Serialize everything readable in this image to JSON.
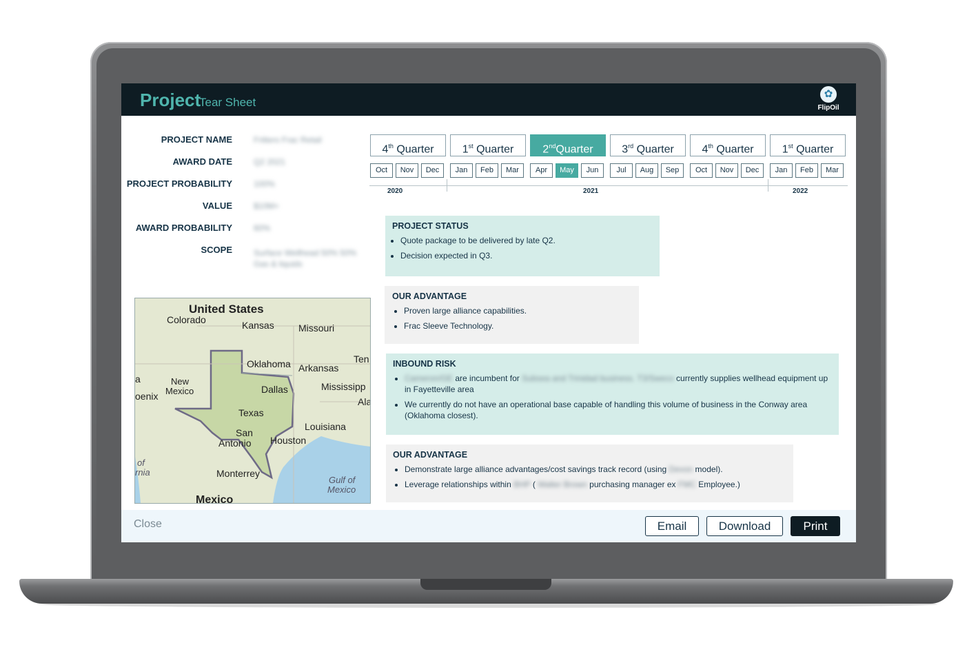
{
  "header": {
    "title": "Project",
    "subtitle": "Tear Sheet",
    "logo": "FlipOil"
  },
  "fields": [
    {
      "label": "PROJECT NAME",
      "value": "Fritters Frac Retail"
    },
    {
      "label": "AWARD DATE",
      "value": "Q2 2021"
    },
    {
      "label": "PROJECT PROBABILITY",
      "value": "100%"
    },
    {
      "label": "VALUE",
      "value": "$10M+"
    },
    {
      "label": "AWARD PROBABILITY",
      "value": "60%"
    },
    {
      "label": "SCOPE",
      "value": "Surface Wellhead 50% 50% Gas & liquids"
    }
  ],
  "map": {
    "labels": [
      "United States",
      "Colorado",
      "Kansas",
      "Missouri",
      "Oklahoma",
      "Arkansas",
      "Ten",
      "New Mexico",
      "Dallas",
      "Mississipp",
      "Ala",
      "oenix",
      "a",
      "Texas",
      "Louisiana",
      "San Antonio",
      "Houston",
      "Monterrey",
      "Gulf of Mexico",
      "Mexico",
      "of rnia"
    ]
  },
  "quarters": [
    {
      "num": "4",
      "sup": "th",
      "label": "Quarter",
      "active": false
    },
    {
      "num": "1",
      "sup": "st",
      "label": "Quarter",
      "active": false
    },
    {
      "num": "2",
      "sup": "nd",
      "label": "Quarter",
      "active": true
    },
    {
      "num": "3",
      "sup": "rd",
      "label": "Quarter",
      "active": false
    },
    {
      "num": "4",
      "sup": "th",
      "label": "Quarter",
      "active": false
    },
    {
      "num": "1",
      "sup": "st",
      "label": "Quarter",
      "active": false
    }
  ],
  "months": [
    "Oct",
    "Nov",
    "Dec",
    "Jan",
    "Feb",
    "Mar",
    "Apr",
    "May",
    "Jun",
    "Jul",
    "Aug",
    "Sep",
    "Oct",
    "Nov",
    "Dec",
    "Jan",
    "Feb",
    "Mar"
  ],
  "selected_month": "May",
  "years": [
    "2020",
    "2021",
    "2022"
  ],
  "cards": {
    "status": {
      "title": "PROJECT STATUS",
      "items": [
        "Quote package to be delivered by late Q2.",
        "Decision expected in Q3."
      ]
    },
    "advantage1": {
      "title": "OUR ADVANTAGE",
      "items": [
        "Proven large alliance capabilities.",
        "Frac Sleeve Technology."
      ]
    },
    "risk": {
      "title": "INBOUND RISK",
      "item1": {
        "blur1": "Cameron/GE",
        "t1": " are incumbent for ",
        "blur2": "Subsea and Trinidad business. T3/Sweco",
        "t2": " currently supplies wellhead equipment up in Fayetteville area"
      },
      "item2": "We currently do not have an operational base capable of handling this volume of business in the Conway area (Oklahoma closest)."
    },
    "advantage2": {
      "title": "OUR ADVANTAGE",
      "item1": {
        "t1": "Demonstrate large alliance advantages/cost savings track record (using ",
        "blur": "Devon",
        "t2": " model)."
      },
      "item2": {
        "t1": "Leverage relationships within ",
        "blur1": "BHP",
        "t2": " ( ",
        "blur2": "Walter Brown",
        "t3": " purchasing manager ex ",
        "blur3": "FMC",
        "t4": " Employee.)"
      }
    }
  },
  "footer": {
    "close": "Close",
    "email": "Email",
    "download": "Download",
    "print": "Print"
  },
  "colors": {
    "accent": "#47aaa1",
    "dark": "#0e1c23",
    "teal_card": "#d5ede9"
  }
}
